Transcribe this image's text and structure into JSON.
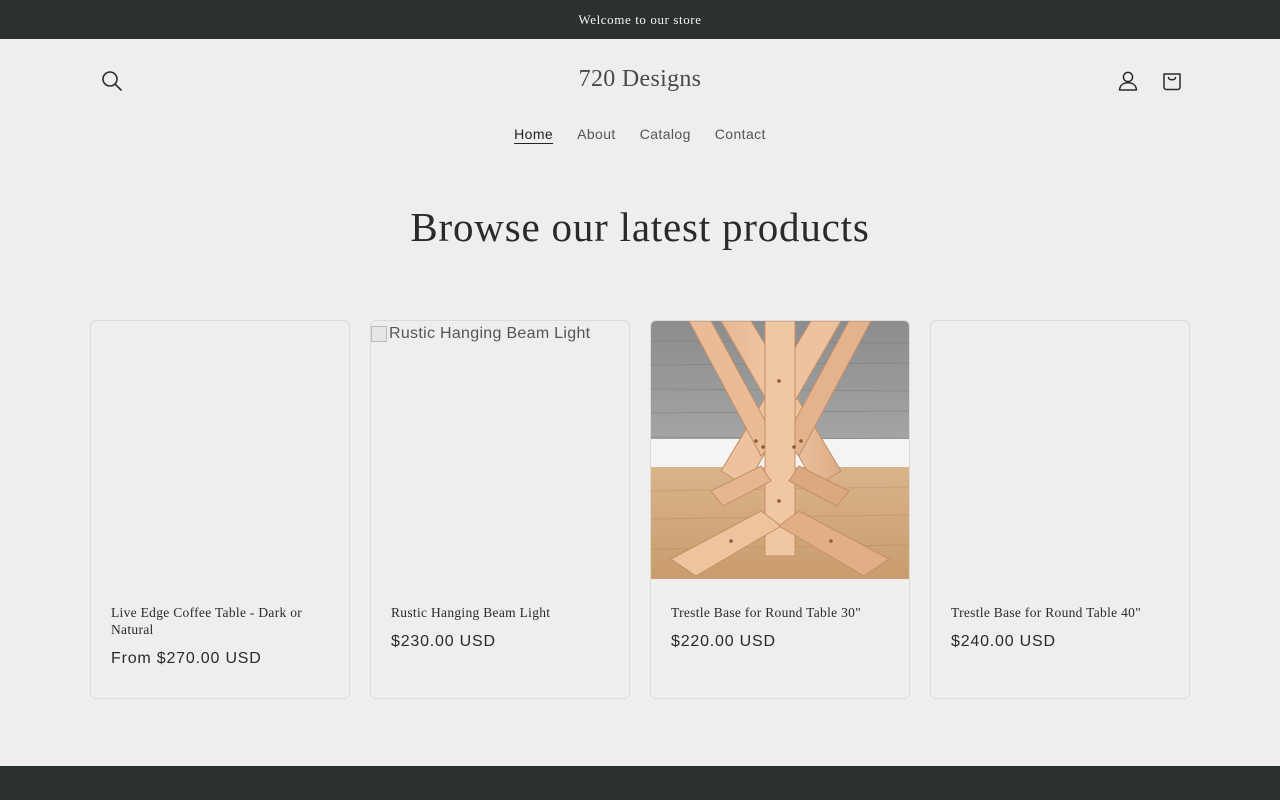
{
  "announcement": {
    "text": "Welcome to our store"
  },
  "header": {
    "logo": "720 Designs",
    "icons": {
      "search": "search-icon",
      "account": "account-icon",
      "cart": "cart-icon"
    }
  },
  "nav": {
    "items": [
      {
        "label": "Home",
        "active": true
      },
      {
        "label": "About",
        "active": false
      },
      {
        "label": "Catalog",
        "active": false
      },
      {
        "label": "Contact",
        "active": false
      }
    ]
  },
  "section": {
    "heading": "Browse our latest products"
  },
  "products": [
    {
      "title": "Live Edge Coffee Table - Dark or Natural",
      "price": "From $270.00 USD",
      "image": "blank"
    },
    {
      "title": "Rustic Hanging Beam Light",
      "price": "$230.00 USD",
      "image": "broken",
      "image_alt": "Rustic Hanging Beam Light"
    },
    {
      "title": "Trestle Base for Round Table 30\"",
      "price": "$220.00 USD",
      "image": "photo"
    },
    {
      "title": "Trestle Base for Round Table 40\"",
      "price": "$240.00 USD",
      "image": "blank"
    }
  ],
  "colors": {
    "background": "#efeeec",
    "bar": "#2b312e",
    "text": "#2a2a2a"
  }
}
